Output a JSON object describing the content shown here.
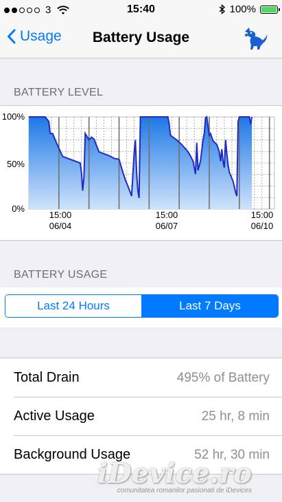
{
  "status_bar": {
    "signal_dots": [
      true,
      true,
      false,
      false,
      false
    ],
    "carrier": "3",
    "time": "15:40",
    "battery_percent": "100%"
  },
  "nav": {
    "back_label": "Usage",
    "title": "Battery Usage"
  },
  "battery_level": {
    "header": "BATTERY LEVEL",
    "y_ticks": [
      "100%",
      "50%",
      "0%"
    ],
    "x_ticks": [
      {
        "time": "15:00",
        "date": "06/04"
      },
      {
        "time": "15:00",
        "date": "06/07"
      },
      {
        "time": "15:00",
        "date": "06/10"
      }
    ]
  },
  "chart_data": {
    "type": "area",
    "title": "",
    "xlabel": "",
    "ylabel": "",
    "ylim": [
      0,
      100
    ],
    "x_unit": "hours",
    "x_range": [
      0,
      196
    ],
    "series": [
      {
        "values": [
          [
            0,
            100
          ],
          [
            13,
            100
          ],
          [
            16,
            95
          ],
          [
            17,
            82
          ],
          [
            19,
            82
          ],
          [
            22,
            72
          ],
          [
            27,
            57
          ],
          [
            35,
            53
          ],
          [
            41,
            50
          ],
          [
            42,
            40
          ],
          [
            43,
            20
          ],
          [
            44,
            35
          ],
          [
            45,
            82
          ],
          [
            48,
            75
          ],
          [
            50,
            78
          ],
          [
            52,
            76
          ],
          [
            56,
            62
          ],
          [
            64,
            58
          ],
          [
            68,
            55
          ],
          [
            72,
            54
          ],
          [
            75,
            40
          ],
          [
            77,
            32
          ],
          [
            79,
            25
          ],
          [
            81,
            18
          ],
          [
            82,
            14
          ],
          [
            84,
            60
          ],
          [
            85,
            75
          ],
          [
            86,
            40
          ],
          [
            87,
            20
          ],
          [
            88,
            12
          ],
          [
            89,
            100
          ],
          [
            111,
            100
          ],
          [
            112,
            92
          ],
          [
            113,
            80
          ],
          [
            118,
            75
          ],
          [
            122,
            70
          ],
          [
            126,
            64
          ],
          [
            128,
            60
          ],
          [
            130,
            55
          ],
          [
            131,
            52
          ],
          [
            132,
            45
          ],
          [
            133,
            38
          ],
          [
            134,
            72
          ],
          [
            135,
            42
          ],
          [
            136,
            47
          ],
          [
            137,
            52
          ],
          [
            139,
            75
          ],
          [
            140,
            82
          ],
          [
            141,
            99
          ],
          [
            142,
            100
          ],
          [
            143,
            90
          ],
          [
            144,
            80
          ],
          [
            145,
            82
          ],
          [
            147,
            74
          ],
          [
            150,
            70
          ],
          [
            152,
            62
          ],
          [
            153,
            52
          ],
          [
            154,
            65
          ],
          [
            155,
            52
          ],
          [
            156,
            45
          ],
          [
            157,
            75
          ],
          [
            158,
            60
          ],
          [
            159,
            48
          ],
          [
            160,
            40
          ],
          [
            163,
            30
          ],
          [
            165,
            18
          ],
          [
            166,
            14
          ],
          [
            167,
            95
          ],
          [
            168,
            100
          ],
          [
            176,
            100
          ],
          [
            177,
            92
          ],
          [
            178,
            100
          ]
        ]
      }
    ],
    "annotations": [],
    "grid": true
  },
  "battery_usage": {
    "header": "BATTERY USAGE",
    "tabs": [
      {
        "label": "Last 24 Hours",
        "active": false
      },
      {
        "label": "Last 7 Days",
        "active": true
      }
    ],
    "rows": [
      {
        "label": "Total Drain",
        "value": "495% of Battery"
      },
      {
        "label": "Active Usage",
        "value": "25 hr, 8 min"
      },
      {
        "label": "Background Usage",
        "value": "52 hr, 30 min"
      }
    ]
  },
  "watermark": {
    "logo": "iDevice.ro",
    "tagline": "comunitatea romanilor pasionati de iDevices"
  },
  "colors": {
    "accent": "#007aff",
    "chart_line": "#1f2bc4",
    "chart_fill_top": "#1e78e6",
    "chart_fill_bottom": "#cfe3fb",
    "battery_green": "#4cd964"
  }
}
